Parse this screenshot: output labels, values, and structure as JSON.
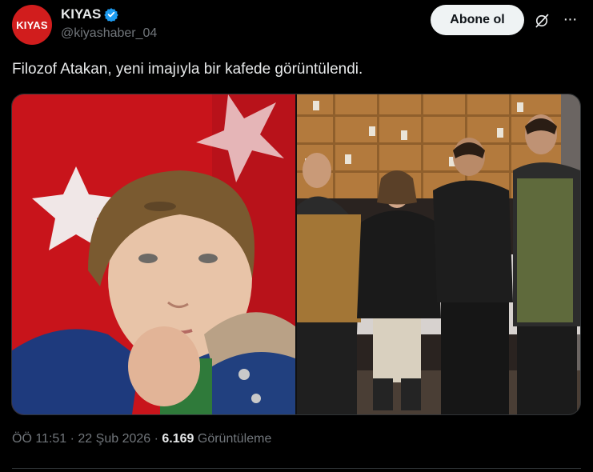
{
  "author": {
    "avatar_text": "KIYAS",
    "display_name": "KIYAS",
    "handle": "@kiyashaber_04",
    "verified": true
  },
  "actions": {
    "subscribe_label": "Abone ol",
    "grok_icon": "grok-slash-icon",
    "more_icon": "more-dots-icon"
  },
  "tweet": {
    "text": "Filozof Atakan, yeni imajıyla bir kafede görüntülendi.",
    "images": [
      {
        "name": "boy-flag-photo"
      },
      {
        "name": "cafe-group-photo"
      }
    ]
  },
  "meta": {
    "time": "ÖÖ 11:51",
    "sep1": " · ",
    "date": "22 Şub 2026",
    "sep2": " · ",
    "views_count": "6.169",
    "views_label": " Görüntüleme"
  },
  "colors": {
    "background": "#000000",
    "text": "#e7e9ea",
    "muted": "#71767b",
    "verified": "#1d9bf0",
    "avatar": "#d11d1d",
    "button": "#eff3f4"
  }
}
